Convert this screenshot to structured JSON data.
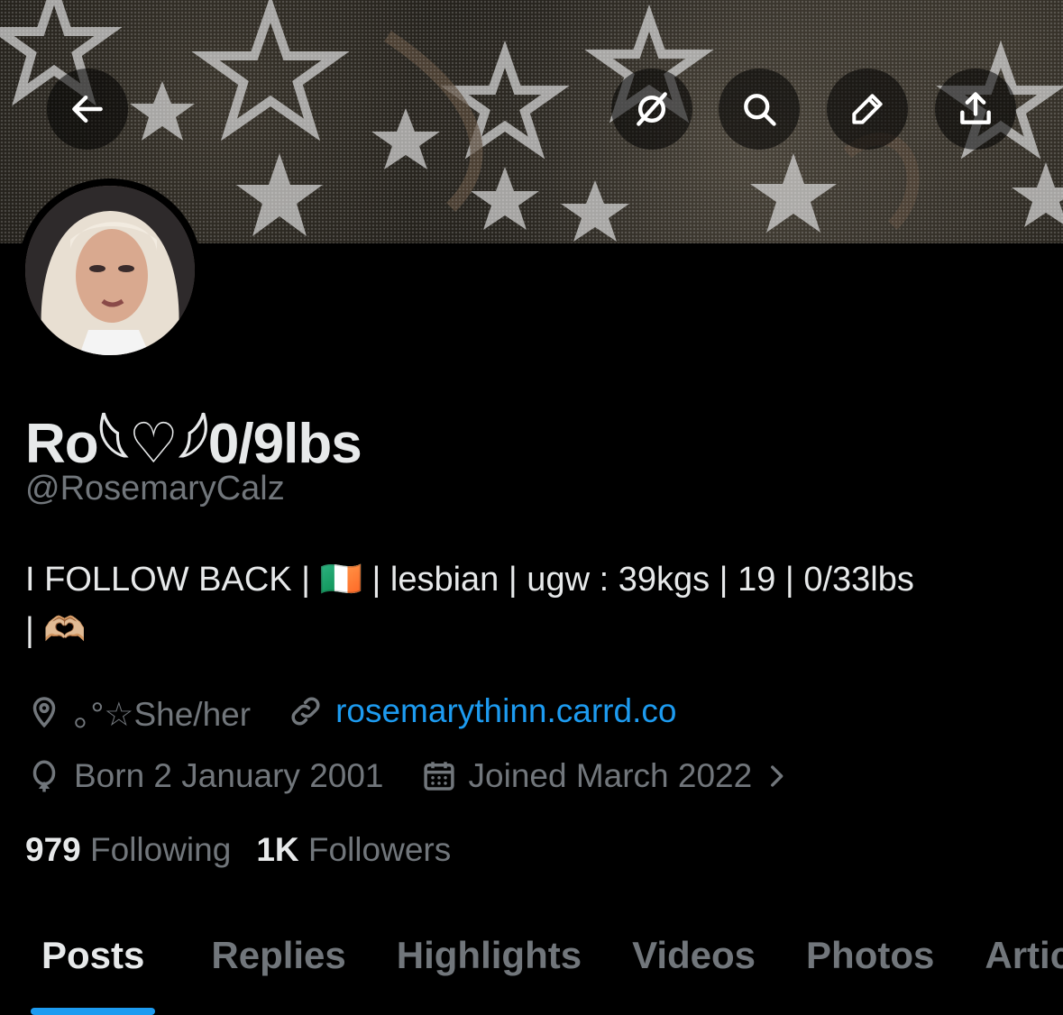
{
  "header": {
    "back_icon": "arrow-left-icon",
    "actions": [
      "grok-icon",
      "search-icon",
      "edit-icon",
      "share-icon"
    ]
  },
  "profile": {
    "display_name": "Ro𓆩♡𓆪0/9lbs",
    "handle": "@RosemaryCalz",
    "bio_line1": "I FOLLOW BACK | 🇮🇪 | lesbian | ugw : 39kgs | 19 | 0/33lbs",
    "bio_line2": "| 🫶🏼",
    "location": "｡°☆She/her",
    "website": "rosemarythinn.carrd.co",
    "birthday": "Born 2 January 2001",
    "joined": "Joined March 2022"
  },
  "stats": {
    "following_count": "979",
    "following_label": "Following",
    "followers_count": "1K",
    "followers_label": "Followers"
  },
  "tabs": [
    "Posts",
    "Replies",
    "Highlights",
    "Videos",
    "Photos",
    "Articles"
  ],
  "colors": {
    "accent": "#1d9bf0",
    "muted": "#71767b",
    "text": "#e7e9ea",
    "background": "#000000"
  }
}
